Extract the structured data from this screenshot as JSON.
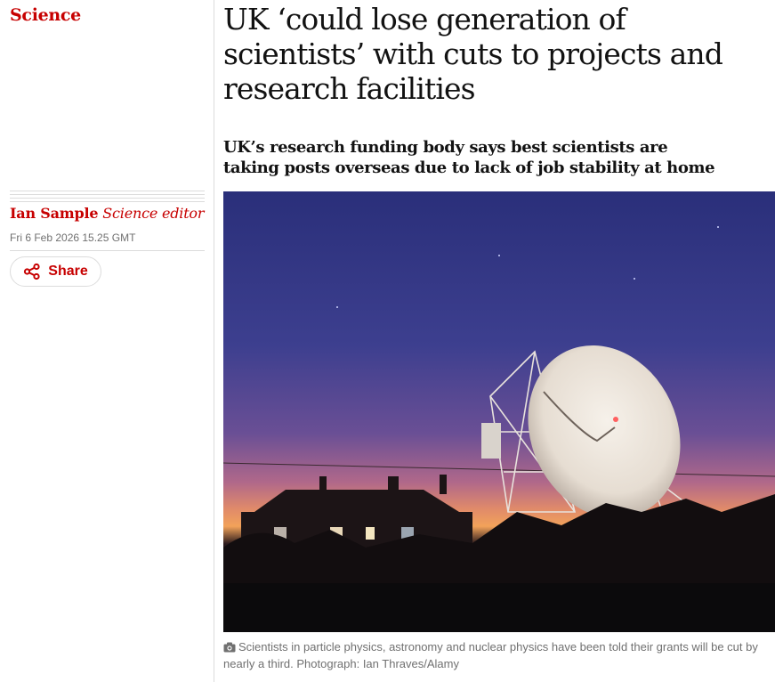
{
  "section": {
    "label": "Science"
  },
  "byline": {
    "author": "Ian Sample",
    "role": "Science editor"
  },
  "dateline": "Fri 6 Feb 2026 15.25 GMT",
  "share": {
    "label": "Share",
    "icon": "share-icon"
  },
  "article": {
    "headline": "UK ‘could lose generation of scientists’ with cuts to projects and research facilities",
    "standfirst": "UK’s research funding body says best scientists are taking posts overseas due to lack of job stability at home"
  },
  "media": {
    "caption": "Scientists in particle physics, astronomy and nuclear physics have been told their grants will be cut by nearly a third. Photograph: Ian Thraves/Alamy",
    "caption_icon": "camera-icon"
  },
  "colors": {
    "accent": "#c70000",
    "text": "#121212",
    "muted": "#707070",
    "rule": "#dcdcdc"
  }
}
